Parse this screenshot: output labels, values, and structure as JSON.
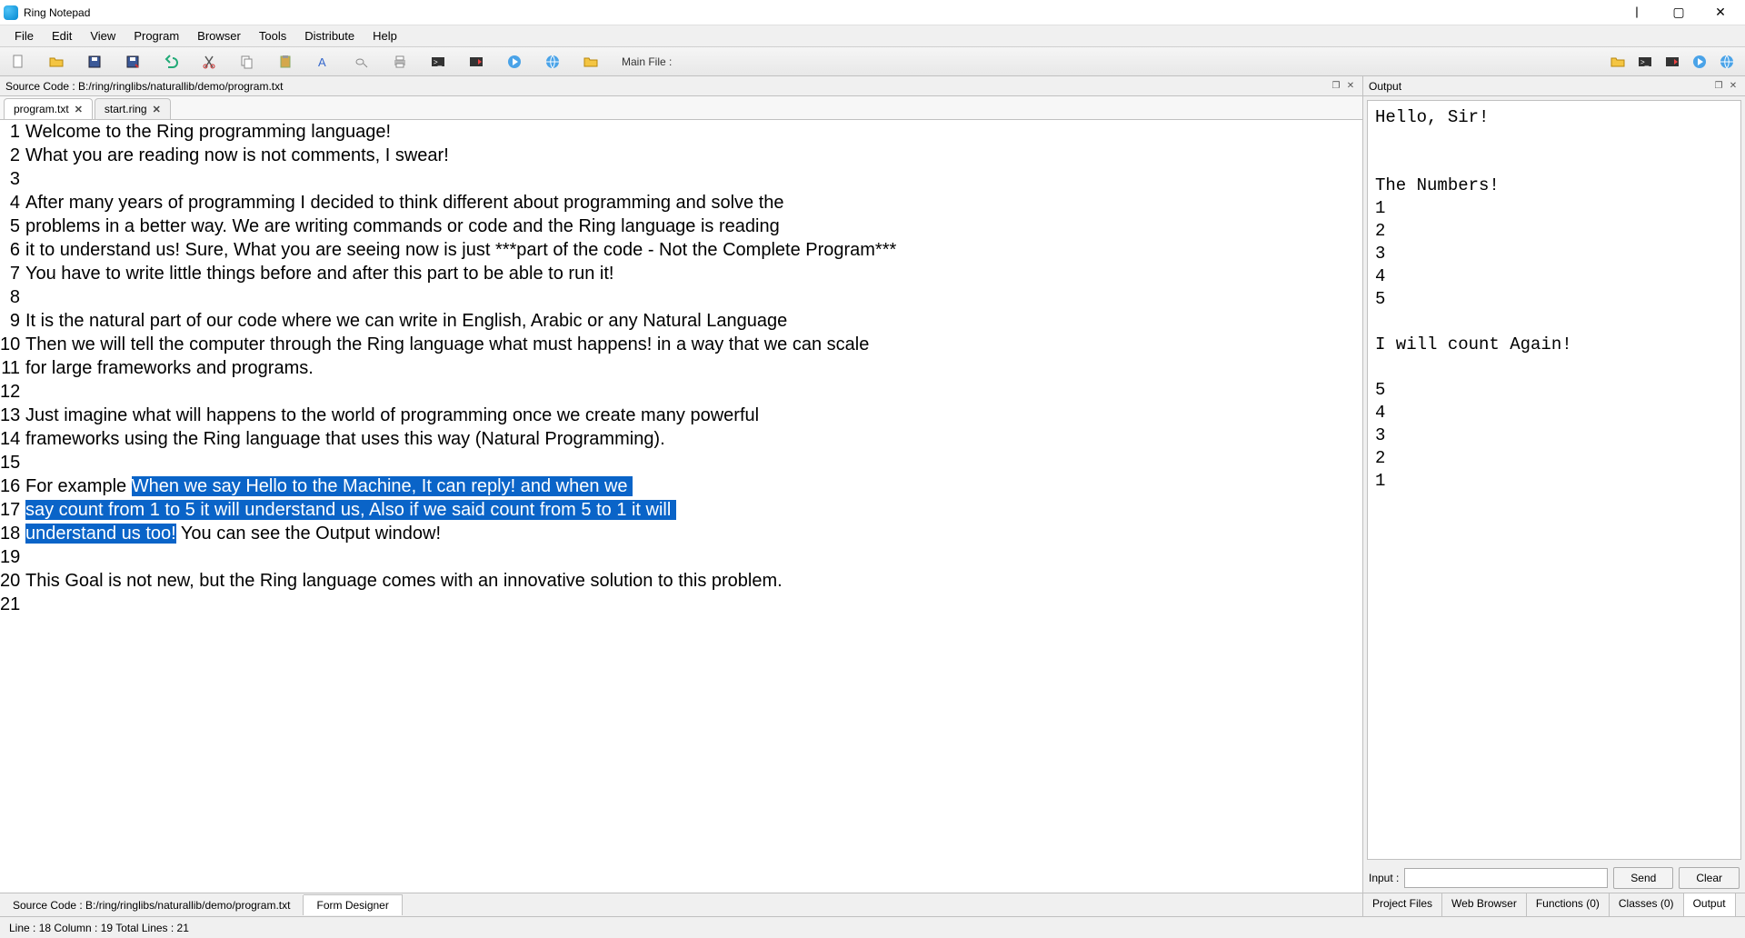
{
  "window": {
    "title": "Ring Notepad"
  },
  "menu": [
    "File",
    "Edit",
    "View",
    "Program",
    "Browser",
    "Tools",
    "Distribute",
    "Help"
  ],
  "toolbar": {
    "main_file_label": "Main File :"
  },
  "source_header": {
    "label": "Source Code : B:/ring/ringlibs/naturallib/demo/program.txt"
  },
  "tabs": [
    {
      "label": "program.txt",
      "active": true
    },
    {
      "label": "start.ring",
      "active": false
    }
  ],
  "editor_lines": [
    {
      "n": 1,
      "segs": [
        {
          "t": "Welcome to the Ring programming language!"
        }
      ]
    },
    {
      "n": 2,
      "segs": [
        {
          "t": "What you are reading now is not comments, I swear!"
        }
      ]
    },
    {
      "n": 3,
      "segs": [
        {
          "t": ""
        }
      ]
    },
    {
      "n": 4,
      "segs": [
        {
          "t": "After many years of programming I decided to think different about programming and solve the"
        }
      ]
    },
    {
      "n": 5,
      "segs": [
        {
          "t": "problems in a better way. We are writing commands or code and the Ring language is reading"
        }
      ]
    },
    {
      "n": 6,
      "segs": [
        {
          "t": "it to understand us! Sure, What you are seeing now is just ***part of the code - Not the Complete Program***"
        }
      ]
    },
    {
      "n": 7,
      "segs": [
        {
          "t": "You have to write little things before and after this part to be able to run it!"
        }
      ]
    },
    {
      "n": 8,
      "segs": [
        {
          "t": ""
        }
      ]
    },
    {
      "n": 9,
      "segs": [
        {
          "t": "It is the natural part of our code where we can write in English, Arabic or any Natural Language"
        }
      ]
    },
    {
      "n": 10,
      "segs": [
        {
          "t": "Then we will tell the computer through the Ring language what must happens! in a way that we can scale"
        }
      ]
    },
    {
      "n": 11,
      "segs": [
        {
          "t": "for large frameworks and programs."
        }
      ]
    },
    {
      "n": 12,
      "segs": [
        {
          "t": ""
        }
      ]
    },
    {
      "n": 13,
      "segs": [
        {
          "t": "Just imagine what will happens to the world of programming once we create many powerful"
        }
      ]
    },
    {
      "n": 14,
      "segs": [
        {
          "t": "frameworks using the Ring language that uses this way (Natural Programming)."
        }
      ]
    },
    {
      "n": 15,
      "segs": [
        {
          "t": ""
        }
      ]
    },
    {
      "n": 16,
      "segs": [
        {
          "t": "For example "
        },
        {
          "t": "When we say Hello to the Machine, It can reply! and when we ",
          "hl": true
        }
      ]
    },
    {
      "n": 17,
      "segs": [
        {
          "t": "say count from 1 to 5 it will understand us, Also if we said count from 5 to 1 it will ",
          "hl": true
        }
      ]
    },
    {
      "n": 18,
      "segs": [
        {
          "t": "understand us too!",
          "hl": true
        },
        {
          "t": " You can see the Output window!"
        }
      ]
    },
    {
      "n": 19,
      "segs": [
        {
          "t": ""
        }
      ]
    },
    {
      "n": 20,
      "segs": [
        {
          "t": "This Goal is not new, but the Ring language comes with an innovative solution to this problem."
        }
      ]
    },
    {
      "n": 21,
      "segs": [
        {
          "t": ""
        }
      ]
    }
  ],
  "output": {
    "title": "Output",
    "text": "Hello, Sir!\n\n\nThe Numbers!\n1\n2\n3\n4\n5\n\nI will count Again!\n\n5\n4\n3\n2\n1",
    "input_label": "Input :",
    "send_label": "Send",
    "clear_label": "Clear"
  },
  "bottom_tabs_left": [
    {
      "label": "Source Code : B:/ring/ringlibs/naturallib/demo/program.txt",
      "active": false
    },
    {
      "label": "Form Designer",
      "active": true
    }
  ],
  "bottom_tabs_right": [
    {
      "label": "Project Files",
      "active": false
    },
    {
      "label": "Web Browser",
      "active": false
    },
    {
      "label": "Functions (0)",
      "active": false
    },
    {
      "label": "Classes (0)",
      "active": false
    },
    {
      "label": "Output",
      "active": true
    }
  ],
  "status": "Line : 18 Column : 19 Total Lines : 21"
}
